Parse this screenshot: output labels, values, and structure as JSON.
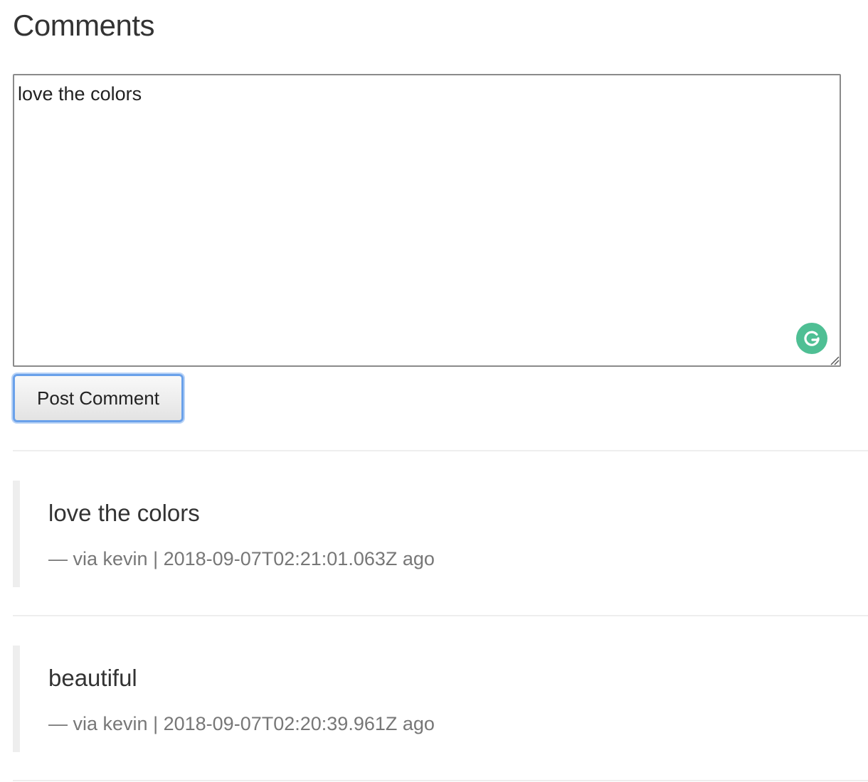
{
  "page": {
    "heading": "Comments"
  },
  "composer": {
    "value": "love the colors",
    "submit_label": "Post Comment",
    "grammarly_icon": "grammarly-g-icon",
    "grammarly_color": "#4fbf94",
    "focus_color": "#6aa1ea"
  },
  "comments": [
    {
      "text": "love the colors",
      "dash": "—",
      "via": "via kevin",
      "separator": "|",
      "timestamp": "2018-09-07T02:21:01.063Z",
      "suffix": "ago"
    },
    {
      "text": "beautiful",
      "dash": "—",
      "via": "via kevin",
      "separator": "|",
      "timestamp": "2018-09-07T02:20:39.961Z",
      "suffix": "ago"
    }
  ]
}
